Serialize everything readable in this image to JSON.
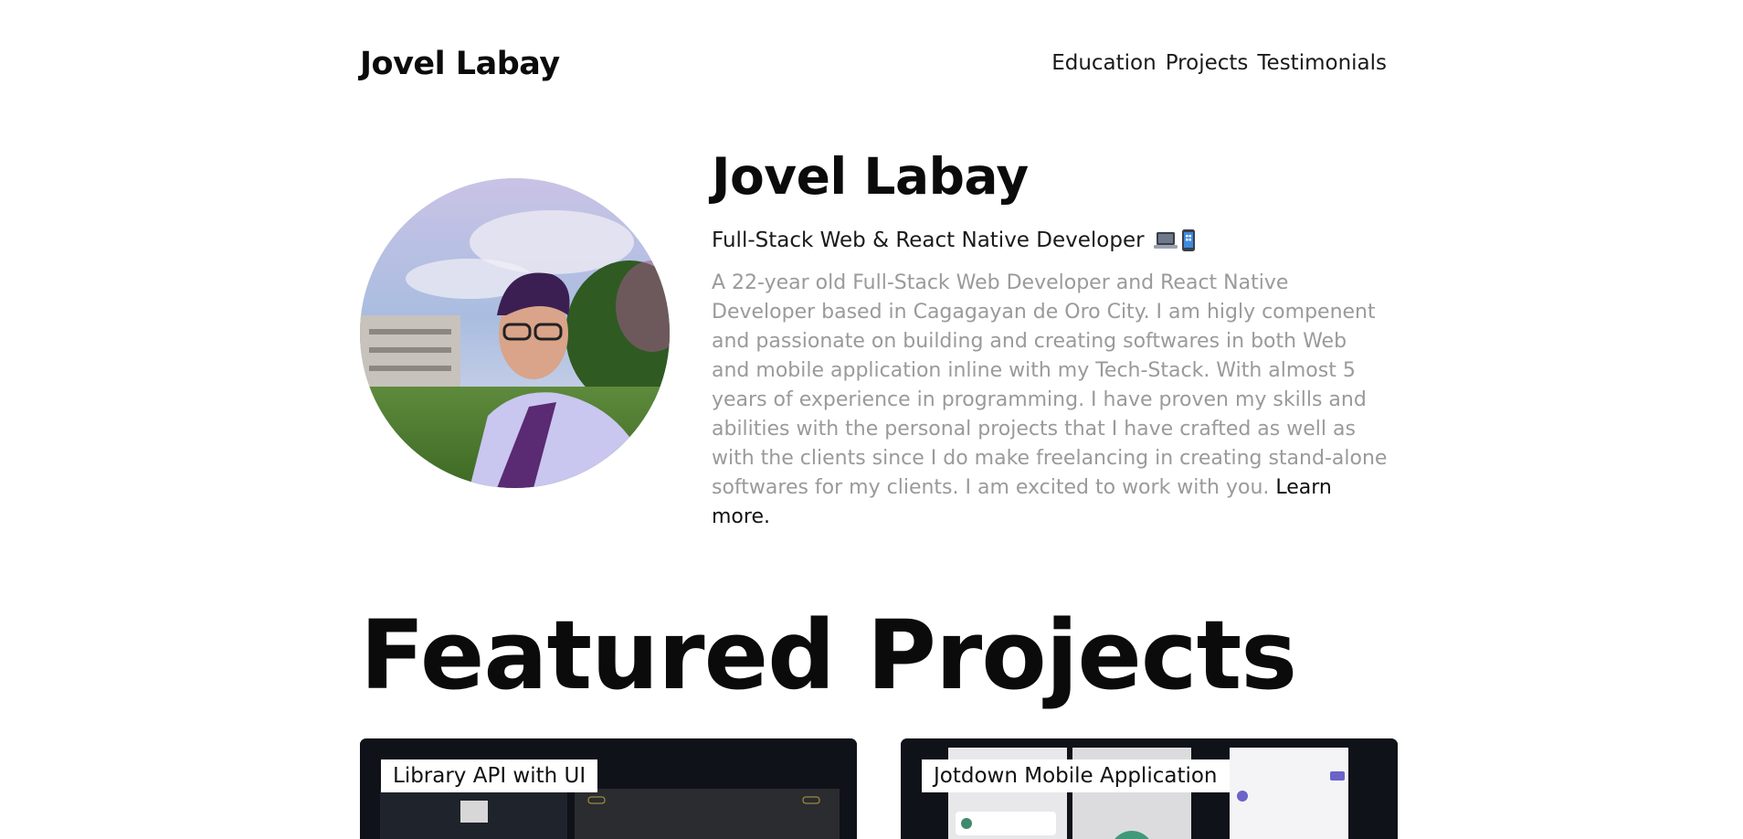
{
  "header": {
    "brand": "Jovel Labay",
    "nav": [
      "Education",
      "Projects",
      "Testimonials"
    ]
  },
  "hero": {
    "name": "Jovel Labay",
    "role": "Full-Stack Web & React Native Developer",
    "role_icons": [
      "laptop-icon",
      "mobile-phone-icon"
    ],
    "bio": "A 22-year old Full-Stack Web Developer and React Native Developer based in Cagagayan de Oro City. I am higly compenent and passionate on building and creating softwares in both Web and mobile application inline with my Tech-Stack. With almost 5 years of experience in programming. I have proven my skills and abilities with the personal projects that I have crafted as well as with the clients since I do make freelancing in creating stand-alone softwares for my clients. I am excited to work with you.",
    "learn_more": "Learn more."
  },
  "featured": {
    "title": "Featured Projects",
    "projects": [
      {
        "label": "Library API with UI"
      },
      {
        "label": "Jotdown Mobile Application"
      }
    ]
  }
}
